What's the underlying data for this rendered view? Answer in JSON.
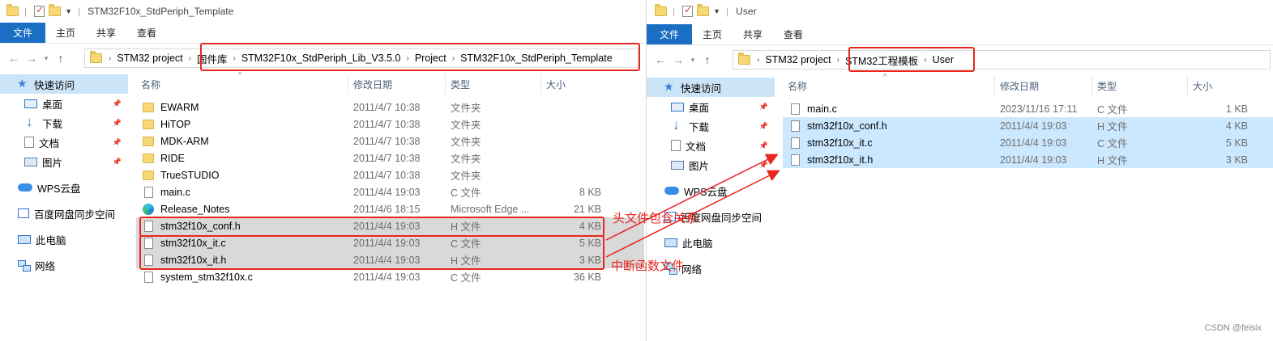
{
  "left": {
    "title": "STM32F10x_StdPeriph_Template",
    "ribbon": [
      "文件",
      "主页",
      "共享",
      "查看"
    ],
    "breadcrumbs": [
      "STM32 project",
      "固件库",
      "STM32F10x_StdPeriph_Lib_V3.5.0",
      "Project",
      "STM32F10x_StdPeriph_Template"
    ],
    "columns": {
      "name": "名称",
      "date": "修改日期",
      "type": "类型",
      "size": "大小"
    },
    "files": [
      {
        "name": "EWARM",
        "date": "2011/4/7 10:38",
        "type": "文件夹",
        "size": "",
        "icon": "folder-icon"
      },
      {
        "name": "HiTOP",
        "date": "2011/4/7 10:38",
        "type": "文件夹",
        "size": "",
        "icon": "folder-icon"
      },
      {
        "name": "MDK-ARM",
        "date": "2011/4/7 10:38",
        "type": "文件夹",
        "size": "",
        "icon": "folder-icon"
      },
      {
        "name": "RIDE",
        "date": "2011/4/7 10:38",
        "type": "文件夹",
        "size": "",
        "icon": "folder-icon"
      },
      {
        "name": "TrueSTUDIO",
        "date": "2011/4/7 10:38",
        "type": "文件夹",
        "size": "",
        "icon": "folder-icon"
      },
      {
        "name": "main.c",
        "date": "2011/4/4 19:03",
        "type": "C 文件",
        "size": "8 KB",
        "icon": "file-icon"
      },
      {
        "name": "Release_Notes",
        "date": "2011/4/6 18:15",
        "type": "Microsoft Edge ...",
        "size": "21 KB",
        "icon": "edge-icon"
      },
      {
        "name": "stm32f10x_conf.h",
        "date": "2011/4/4 19:03",
        "type": "H 文件",
        "size": "4 KB",
        "icon": "file-icon"
      },
      {
        "name": "stm32f10x_it.c",
        "date": "2011/4/4 19:03",
        "type": "C 文件",
        "size": "5 KB",
        "icon": "file-icon"
      },
      {
        "name": "stm32f10x_it.h",
        "date": "2011/4/4 19:03",
        "type": "H 文件",
        "size": "3 KB",
        "icon": "file-icon"
      },
      {
        "name": "system_stm32f10x.c",
        "date": "2011/4/4 19:03",
        "type": "C 文件",
        "size": "36 KB",
        "icon": "file-icon"
      }
    ]
  },
  "right": {
    "title": "User",
    "ribbon": [
      "文件",
      "主页",
      "共享",
      "查看"
    ],
    "breadcrumbs": [
      "STM32 project",
      "STM32工程模板",
      "User"
    ],
    "columns": {
      "name": "名称",
      "date": "修改日期",
      "type": "类型",
      "size": "大小"
    },
    "files": [
      {
        "name": "main.c",
        "date": "2023/11/16 17:11",
        "type": "C 文件",
        "size": "1 KB",
        "icon": "file-icon"
      },
      {
        "name": "stm32f10x_conf.h",
        "date": "2011/4/4 19:03",
        "type": "H 文件",
        "size": "4 KB",
        "icon": "file-icon"
      },
      {
        "name": "stm32f10x_it.c",
        "date": "2011/4/4 19:03",
        "type": "C 文件",
        "size": "5 KB",
        "icon": "file-icon"
      },
      {
        "name": "stm32f10x_it.h",
        "date": "2011/4/4 19:03",
        "type": "H 文件",
        "size": "3 KB",
        "icon": "file-icon"
      }
    ]
  },
  "sidebar": [
    {
      "label": "快速访问",
      "icon": "quick-access-star-icon"
    },
    {
      "label": "桌面",
      "icon": "desktop-icon",
      "pinned": true
    },
    {
      "label": "下载",
      "icon": "download-icon",
      "pinned": true
    },
    {
      "label": "文档",
      "icon": "document-icon",
      "pinned": true
    },
    {
      "label": "图片",
      "icon": "pictures-icon",
      "pinned": true
    },
    {
      "label": "WPS云盘",
      "icon": "cloud-icon"
    },
    {
      "label": "百度网盘同步空间",
      "icon": "baidu-netdisk-icon"
    },
    {
      "label": "此电脑",
      "icon": "this-pc-icon"
    },
    {
      "label": "网络",
      "icon": "network-icon"
    }
  ],
  "annotations": {
    "header_relation": "头文件包含关系",
    "interrupt_files": "中断函数文件"
  },
  "watermark": "CSDN @feisix",
  "colors": {
    "accent": "#1a6fc4",
    "annotation_red": "#e8261e",
    "selection_blue": "#cce8ff",
    "selection_gray": "#d9d9d9",
    "nav_selected": "#cce4f7"
  }
}
